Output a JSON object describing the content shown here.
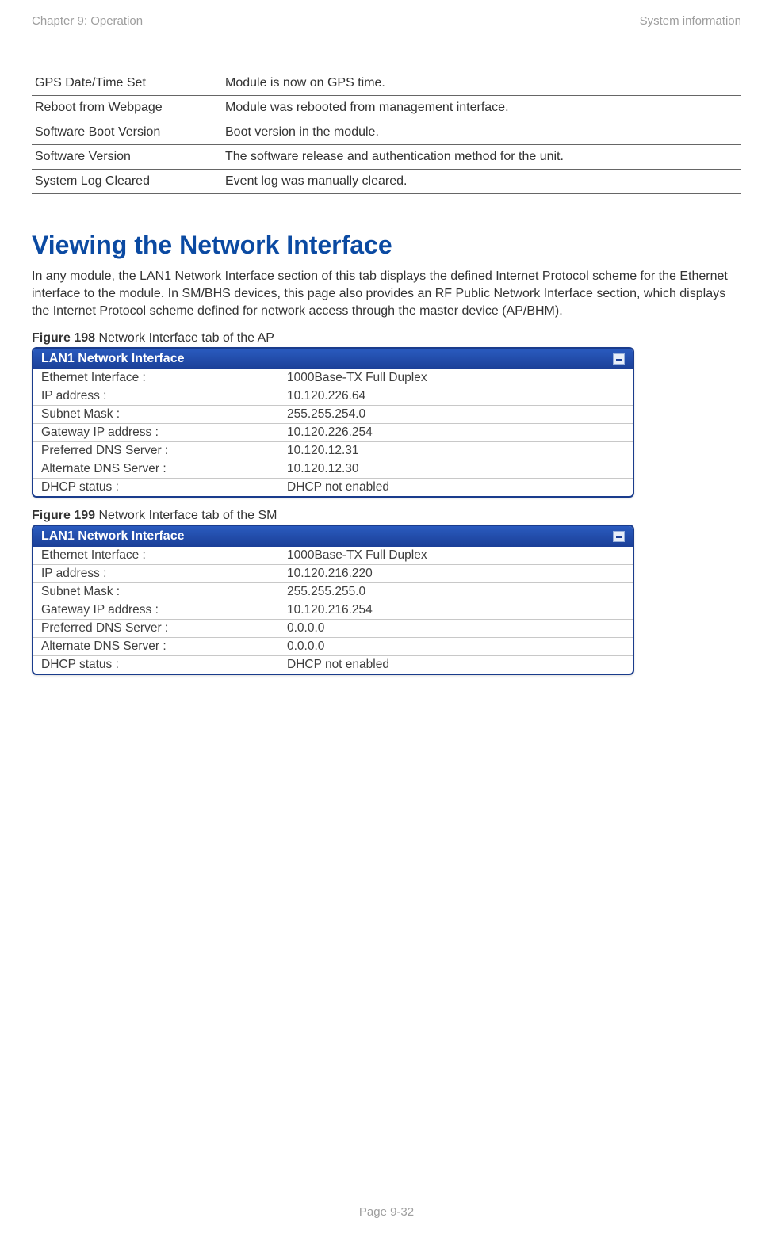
{
  "header": {
    "left": "Chapter 9:  Operation",
    "right": "System information"
  },
  "definitions": [
    {
      "term": "GPS Date/Time Set",
      "desc": "Module is now on GPS time."
    },
    {
      "term": "Reboot from Webpage",
      "desc": "Module was rebooted from management interface."
    },
    {
      "term": "Software Boot Version",
      "desc": "Boot version in the module."
    },
    {
      "term": "Software Version",
      "desc": "The software release and authentication method for the unit."
    },
    {
      "term": "System Log Cleared",
      "desc": "Event log was manually cleared."
    }
  ],
  "section_title": "Viewing the Network Interface",
  "section_body": "In any module, the LAN1 Network Interface section of this tab displays the defined Internet Protocol scheme for the Ethernet interface to the module. In SM/BHS devices, this page also provides an RF Public Network Interface section, which displays the Internet Protocol scheme defined for network access through the master device (AP/BHM).",
  "figures": [
    {
      "num": "Figure 198",
      "caption": " Network Interface tab of the AP",
      "panel_title": "LAN1 Network Interface",
      "rows": [
        {
          "label": "Ethernet Interface :",
          "value": "1000Base-TX Full Duplex"
        },
        {
          "label": "IP address :",
          "value": "10.120.226.64"
        },
        {
          "label": "Subnet Mask :",
          "value": "255.255.254.0"
        },
        {
          "label": "Gateway IP address :",
          "value": "10.120.226.254"
        },
        {
          "label": "Preferred DNS Server :",
          "value": "10.120.12.31"
        },
        {
          "label": "Alternate DNS Server :",
          "value": "10.120.12.30"
        },
        {
          "label": "DHCP status :",
          "value": "DHCP not enabled"
        }
      ]
    },
    {
      "num": "Figure 199",
      "caption": " Network Interface tab of the SM",
      "panel_title": "LAN1 Network Interface",
      "rows": [
        {
          "label": "Ethernet Interface :",
          "value": "1000Base-TX Full Duplex"
        },
        {
          "label": "IP address :",
          "value": "10.120.216.220"
        },
        {
          "label": "Subnet Mask :",
          "value": "255.255.255.0"
        },
        {
          "label": "Gateway IP address :",
          "value": "10.120.216.254"
        },
        {
          "label": "Preferred DNS Server :",
          "value": "0.0.0.0"
        },
        {
          "label": "Alternate DNS Server :",
          "value": "0.0.0.0"
        },
        {
          "label": "DHCP status :",
          "value": "DHCP not enabled"
        }
      ]
    }
  ],
  "footer": "Page 9-32"
}
